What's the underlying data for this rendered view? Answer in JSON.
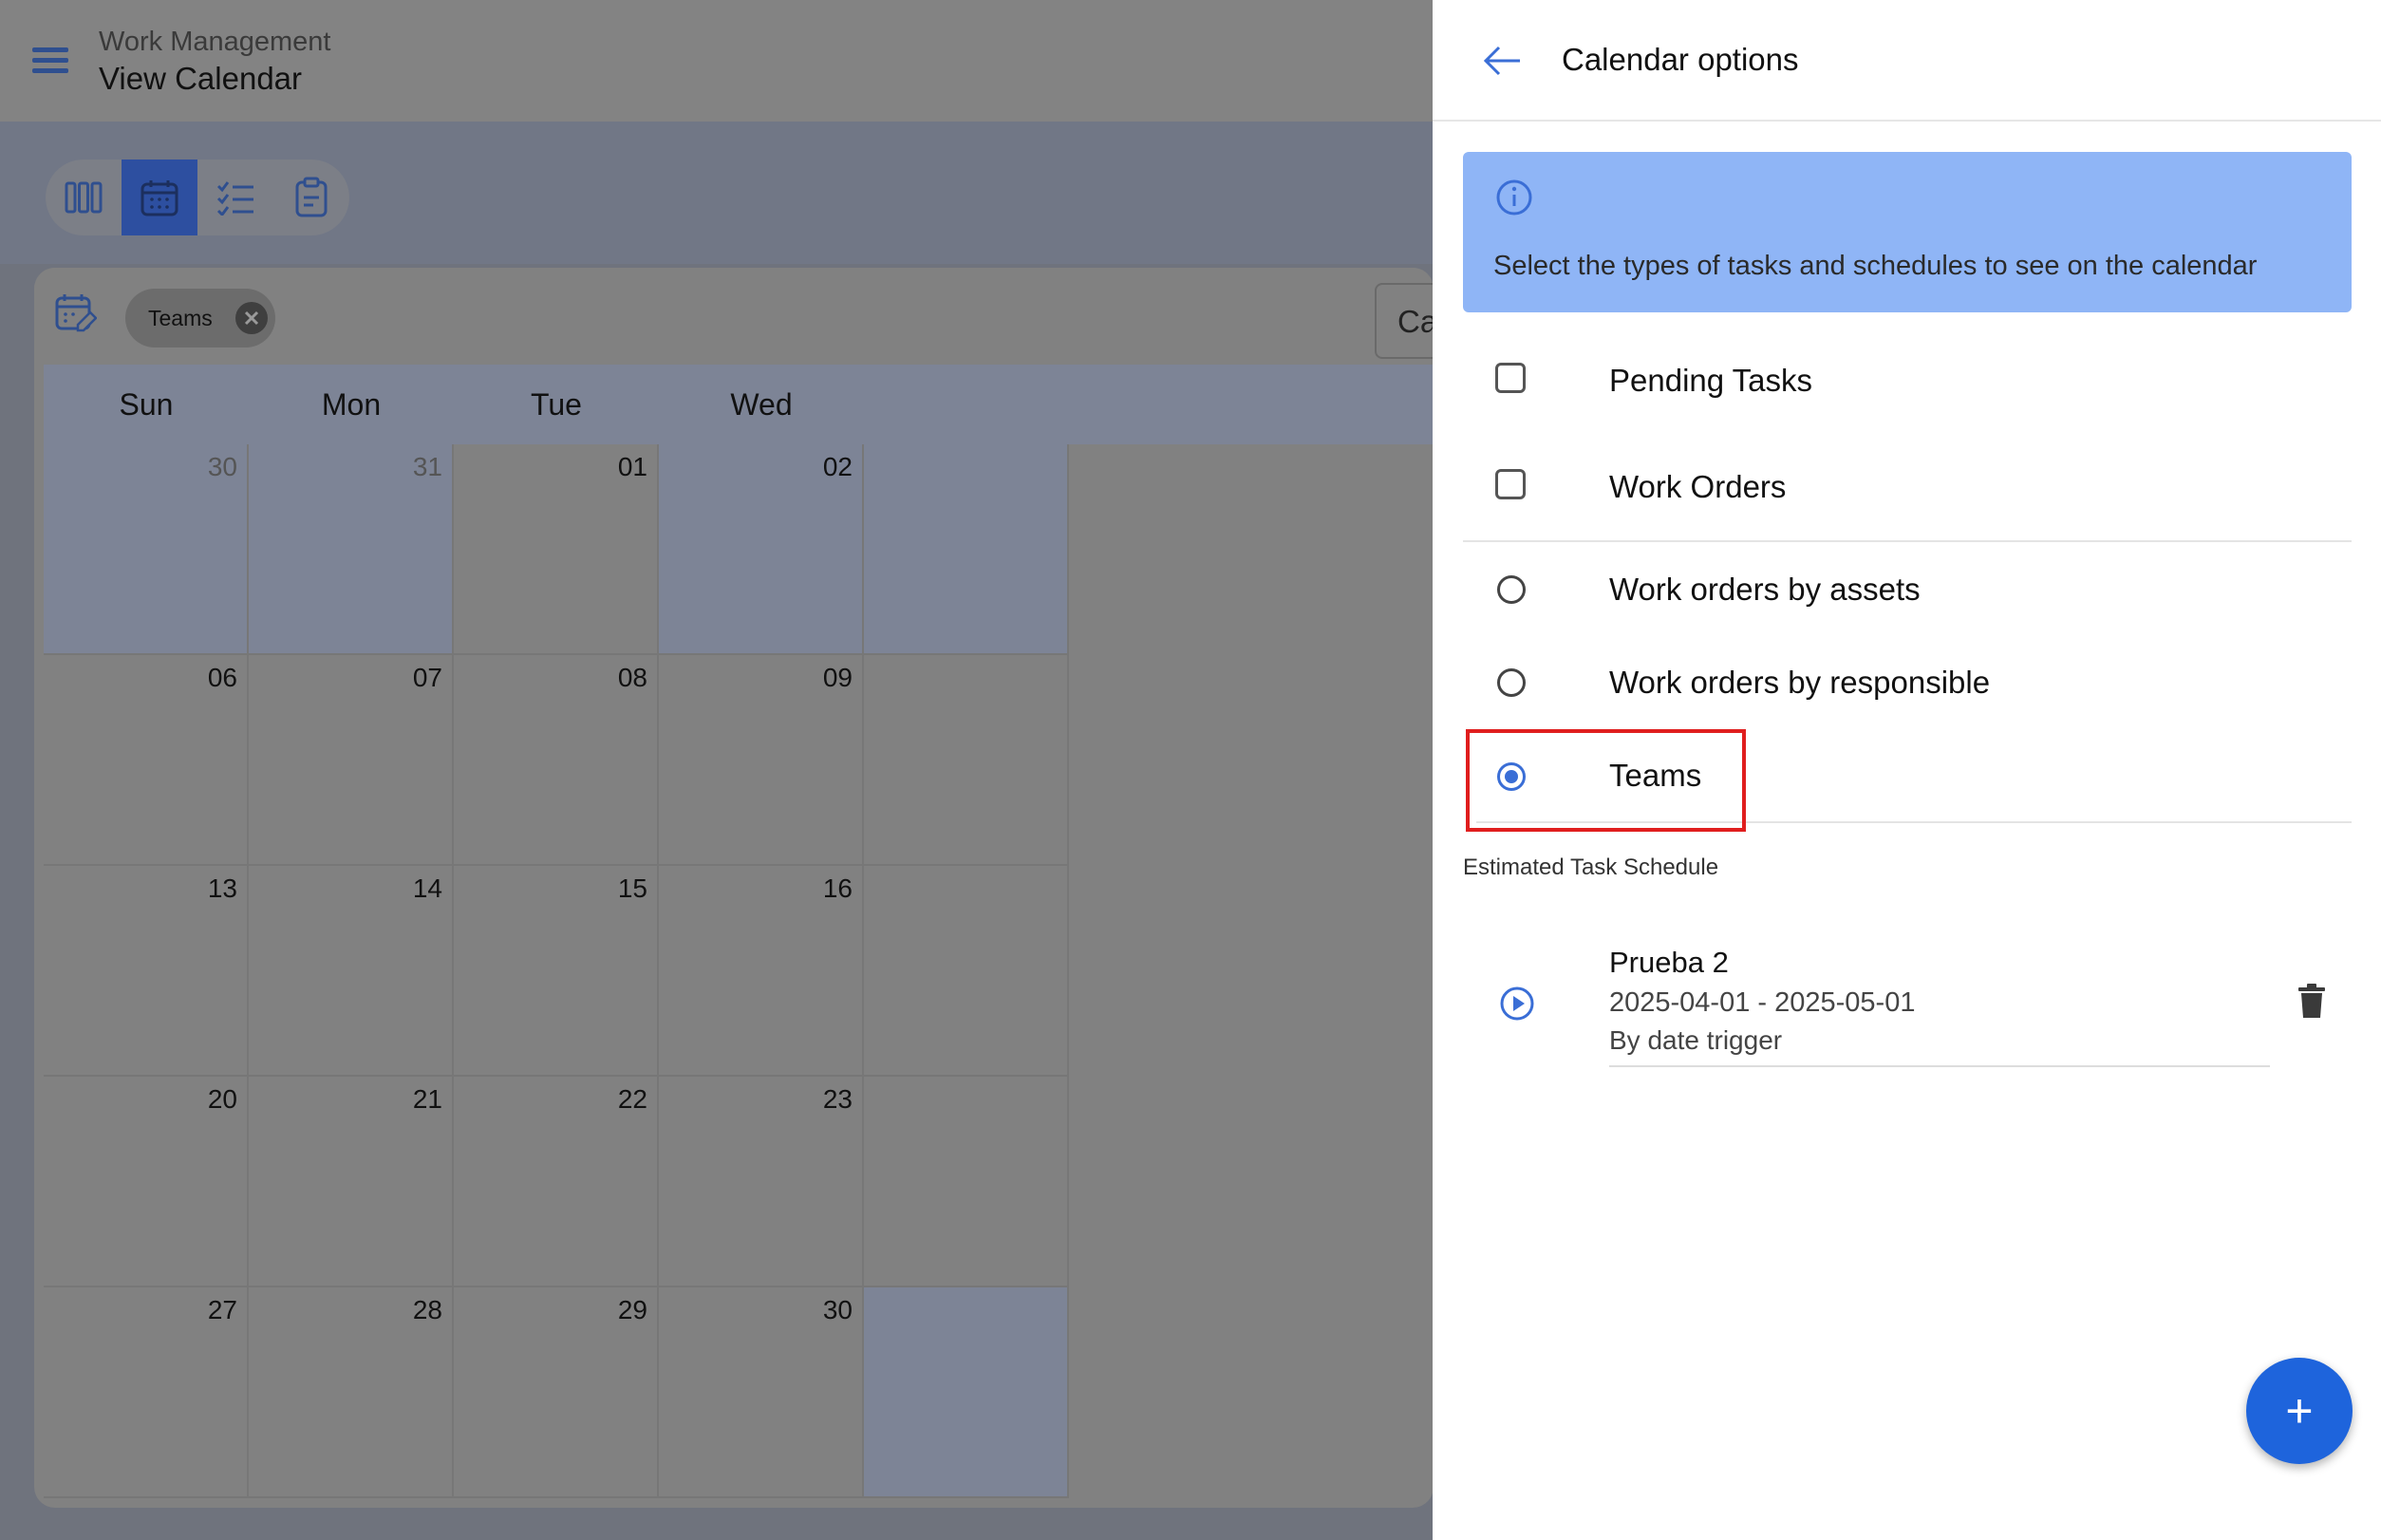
{
  "header": {
    "app_name": "Work Management",
    "page_title": "View Calendar"
  },
  "view_toggle": {
    "buttons": [
      {
        "name": "columns-view-icon",
        "active": false
      },
      {
        "name": "calendar-view-icon",
        "active": true
      },
      {
        "name": "checklist-view-icon",
        "active": false
      },
      {
        "name": "clipboard-view-icon",
        "active": false
      }
    ]
  },
  "calendar": {
    "filter_chip": "Teams",
    "select_text": "Ca",
    "weekdays": [
      "Sun",
      "Mon",
      "Tue",
      "Wed"
    ],
    "weeks": [
      [
        {
          "d": "30",
          "muted": true,
          "other": true
        },
        {
          "d": "31",
          "muted": true,
          "other": true
        },
        {
          "d": "01",
          "muted": false
        },
        {
          "d": "02",
          "muted": true
        }
      ],
      [
        {
          "d": "06",
          "muted": false
        },
        {
          "d": "07",
          "muted": false
        },
        {
          "d": "08",
          "muted": false
        },
        {
          "d": "09",
          "muted": false
        }
      ],
      [
        {
          "d": "13",
          "muted": false
        },
        {
          "d": "14",
          "muted": false
        },
        {
          "d": "15",
          "muted": false
        },
        {
          "d": "16",
          "muted": false
        }
      ],
      [
        {
          "d": "20",
          "muted": false
        },
        {
          "d": "21",
          "muted": false
        },
        {
          "d": "22",
          "muted": false
        },
        {
          "d": "23",
          "muted": false
        }
      ],
      [
        {
          "d": "27",
          "muted": false
        },
        {
          "d": "28",
          "muted": false
        },
        {
          "d": "29",
          "muted": false
        },
        {
          "d": "30",
          "muted": false
        }
      ]
    ]
  },
  "panel": {
    "title": "Calendar options",
    "info_text": "Select the types of tasks and schedules to see on the calendar",
    "checkbox_options": [
      {
        "label": "Pending Tasks",
        "checked": false
      },
      {
        "label": "Work Orders",
        "checked": false
      }
    ],
    "radio_options": [
      {
        "label": "Work orders by assets",
        "selected": false
      },
      {
        "label": "Work orders by responsible",
        "selected": false
      },
      {
        "label": "Teams",
        "selected": true
      }
    ],
    "section_label": "Estimated Task Schedule",
    "schedule": {
      "name": "Prueba 2",
      "dates": "2025-04-01 - 2025-05-01",
      "trigger": "By date trigger"
    },
    "fab_label": "+"
  },
  "colors": {
    "accent": "#1e64dc",
    "radio_selected": "#3a6ed6",
    "highlight": "#e01e1e",
    "info_bg": "#8fb5f6"
  }
}
